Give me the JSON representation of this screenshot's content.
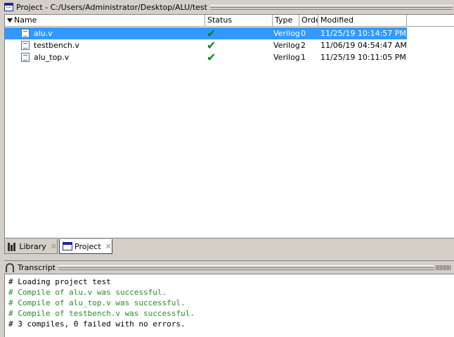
{
  "window": {
    "title": "Project - C:/Users/Administrator/Desktop/ALU/test"
  },
  "columns": [
    "Name",
    "Status",
    "Type",
    "Order",
    "Modified"
  ],
  "files": [
    {
      "name": "alu.v",
      "status": "compiled-check-icon",
      "type": "Verilog",
      "order": "0",
      "modified": "11/25/19 10:14:57 PM",
      "selected": true
    },
    {
      "name": "testbench.v",
      "status": "compiled-check-icon",
      "type": "Verilog",
      "order": "2",
      "modified": "11/06/19 04:54:47 AM",
      "selected": false
    },
    {
      "name": "alu_top.v",
      "status": "compiled-check-icon",
      "type": "Verilog",
      "order": "1",
      "modified": "11/25/19 10:11:05 PM",
      "selected": false
    }
  ],
  "tabs": [
    {
      "label": "Library",
      "active": false
    },
    {
      "label": "Project",
      "active": true
    }
  ],
  "transcript": {
    "title": "Transcript",
    "lines": [
      {
        "text": "# Loading project test",
        "color": "#000000"
      },
      {
        "text": "# Compile of alu.v was successful.",
        "color": "#2a8a2a"
      },
      {
        "text": "# Compile of alu_top.v was successful.",
        "color": "#2a8a2a"
      },
      {
        "text": "# Compile of testbench.v was successful.",
        "color": "#2a8a2a"
      },
      {
        "text": "# 3 compiles, 0 failed with no errors.",
        "color": "#000000"
      }
    ]
  },
  "colors": {
    "selection": "#3399ff",
    "success_text": "#2a8a2a",
    "check": "#118811"
  }
}
